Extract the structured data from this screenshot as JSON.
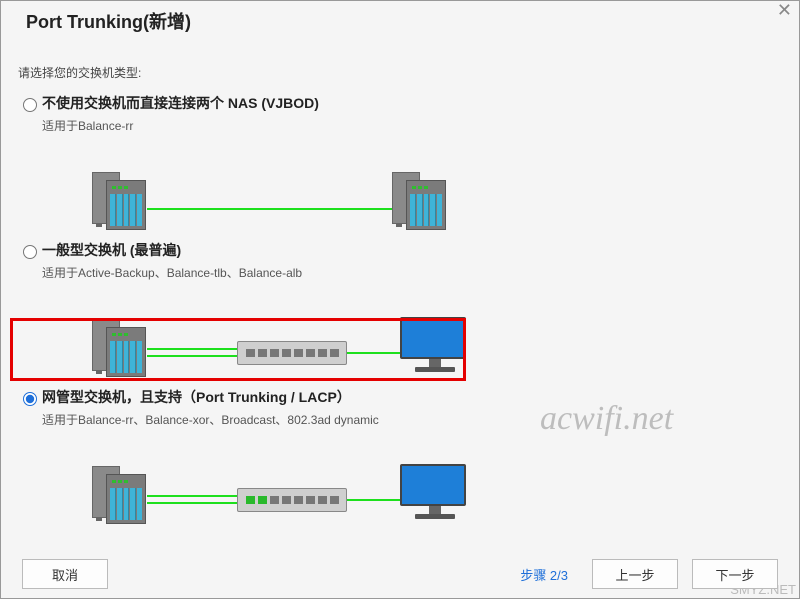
{
  "header": {
    "title": "Port Trunking(新增)"
  },
  "prompt": "请选择您的交换机类型:",
  "options": [
    {
      "title": "不使用交换机而直接连接两个 NAS (VJBOD)",
      "sub": "适用于Balance-rr"
    },
    {
      "title": "一般型交换机 (最普遍)",
      "sub": "适用于Active-Backup、Balance-tlb、Balance-alb"
    },
    {
      "title": "网管型交换机，且支持（Port Trunking / LACP）",
      "sub": "适用于Balance-rr、Balance-xor、Broadcast、802.3ad dynamic"
    }
  ],
  "footer": {
    "cancel": "取消",
    "step": "步骤 2/3",
    "prev": "上一步",
    "next": "下一步"
  },
  "watermark": {
    "main": "acwifi.net",
    "corner": "SMYZ.NET"
  }
}
